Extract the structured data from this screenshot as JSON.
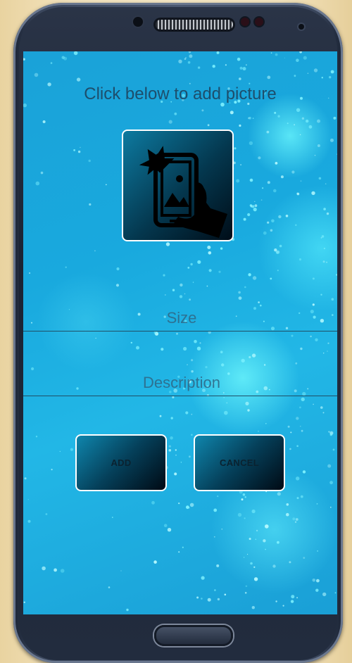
{
  "screen": {
    "title": "Click below to add picture",
    "picture_button_icon": "selfie-photo-icon",
    "size_field": {
      "value": "",
      "placeholder": "Size"
    },
    "description_field": {
      "value": "",
      "placeholder": "Description"
    },
    "add_label": "ADD",
    "cancel_label": "CANCEL"
  },
  "colors": {
    "screen_background": "#1aa2d8",
    "button_dark": "#05405a",
    "border": "#ffffff"
  }
}
